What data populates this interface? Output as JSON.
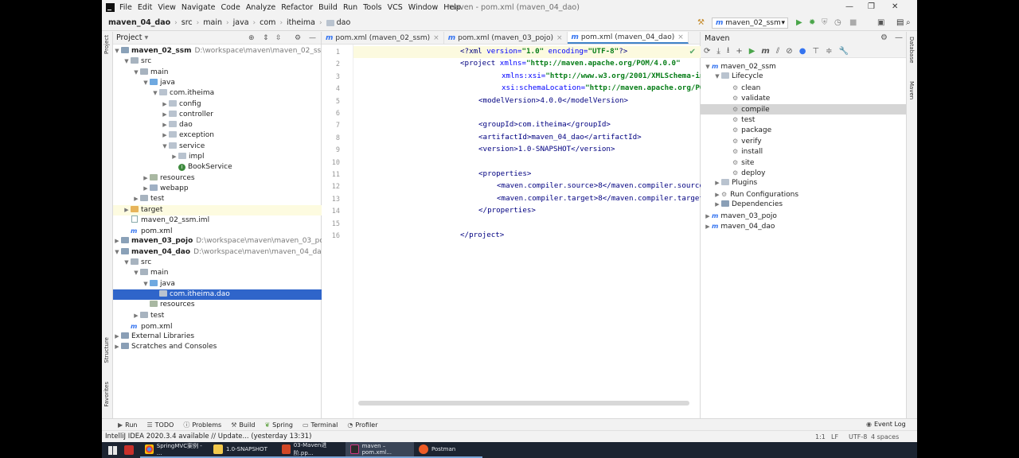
{
  "menu": [
    "File",
    "Edit",
    "View",
    "Navigate",
    "Code",
    "Analyze",
    "Refactor",
    "Build",
    "Run",
    "Tools",
    "VCS",
    "Window",
    "Help"
  ],
  "window_title": "maven - pom.xml (maven_04_dao)",
  "breadcrumb": [
    "maven_04_dao",
    "src",
    "main",
    "java",
    "com",
    "itheima",
    "dao"
  ],
  "run_config": "maven_02_ssm",
  "project_panel": {
    "title": "Project"
  },
  "tree": [
    {
      "label": "maven_02_ssm",
      "path": "D:\\workspace\\maven\\maven_02_ssm"
    },
    {
      "label": "src"
    },
    {
      "label": "main"
    },
    {
      "label": "java"
    },
    {
      "label": "com.itheima"
    },
    {
      "label": "config"
    },
    {
      "label": "controller"
    },
    {
      "label": "dao"
    },
    {
      "label": "exception"
    },
    {
      "label": "service"
    },
    {
      "label": "impl"
    },
    {
      "label": "BookService"
    },
    {
      "label": "resources"
    },
    {
      "label": "webapp"
    },
    {
      "label": "test"
    },
    {
      "label": "target"
    },
    {
      "label": "maven_02_ssm.iml"
    },
    {
      "label": "pom.xml"
    },
    {
      "label": "maven_03_pojo",
      "path": "D:\\workspace\\maven\\maven_03_pojo"
    },
    {
      "label": "maven_04_dao",
      "path": "D:\\workspace\\maven\\maven_04_dao"
    },
    {
      "label": "src"
    },
    {
      "label": "main"
    },
    {
      "label": "java"
    },
    {
      "label": "com.itheima.dao"
    },
    {
      "label": "resources"
    },
    {
      "label": "test"
    },
    {
      "label": "pom.xml"
    },
    {
      "label": "External Libraries"
    },
    {
      "label": "Scratches and Consoles"
    }
  ],
  "editor_tabs": [
    "pom.xml (maven_02_ssm)",
    "pom.xml (maven_03_pojo)",
    "pom.xml (maven_04_dao)"
  ],
  "line_numbers": [
    "1",
    "2",
    "3",
    "4",
    "5",
    "6",
    "7",
    "8",
    "9",
    "10",
    "11",
    "12",
    "13",
    "14",
    "15",
    "16"
  ],
  "code": {
    "l1a": "<?xml ",
    "l1b": "version=",
    "l1c": "\"1.0\" ",
    "l1d": "encoding=",
    "l1e": "\"UTF-8\"",
    "l1f": "?>",
    "l2a": "<project ",
    "l2b": "xmlns=",
    "l2c": "\"http://maven.apache.org/POM/4.0.0\"",
    "l3a": "xmlns:xsi=",
    "l3b": "\"http://www.w3.org/2001/XMLSchema-instance\"",
    "l4a": "xsi:schemaLocation=",
    "l4b": "\"http://maven.apache.org/POM/4.0.0 http://mave",
    "l5": "<modelVersion>4.0.0</modelVersion>",
    "l7": "<groupId>com.itheima</groupId>",
    "l8": "<artifactId>maven_04_dao</artifactId>",
    "l9": "<version>1.0-SNAPSHOT</version>",
    "l11": "<properties>",
    "l12": "<maven.compiler.source>8</maven.compiler.source>",
    "l13": "<maven.compiler.target>8</maven.compiler.target>",
    "l14": "</properties>",
    "l16": "</project>"
  },
  "maven_panel": {
    "title": "Maven",
    "items": [
      "maven_02_ssm",
      "Lifecycle",
      "clean",
      "validate",
      "compile",
      "test",
      "package",
      "verify",
      "install",
      "site",
      "deploy",
      "Plugins",
      "Run Configurations",
      "Dependencies",
      "maven_03_pojo",
      "maven_04_dao"
    ]
  },
  "side_tabs": {
    "project": "Project",
    "structure": "Structure",
    "favorites": "Favorites",
    "database": "Database",
    "maven": "Maven"
  },
  "bottom_tools": [
    "Run",
    "TODO",
    "Problems",
    "Build",
    "Spring",
    "Terminal",
    "Profiler"
  ],
  "event_log": "Event Log",
  "status_message": "IntelliJ IDEA 2020.3.4 available // Update... (yesterday 13:31)",
  "status_right": [
    "1:1",
    "LF",
    "UTF-8",
    "4 spaces"
  ],
  "taskbar": [
    "SpringMVC案例 - ...",
    "1.0-SNAPSHOT",
    "03-Maven进阶.pp...",
    "maven – pom.xml...",
    "Postman"
  ],
  "colors": {
    "selection": "#2f65ca",
    "maven_selection": "#d5d5d5",
    "tag": "#000080",
    "attr_value": "#067d17"
  }
}
